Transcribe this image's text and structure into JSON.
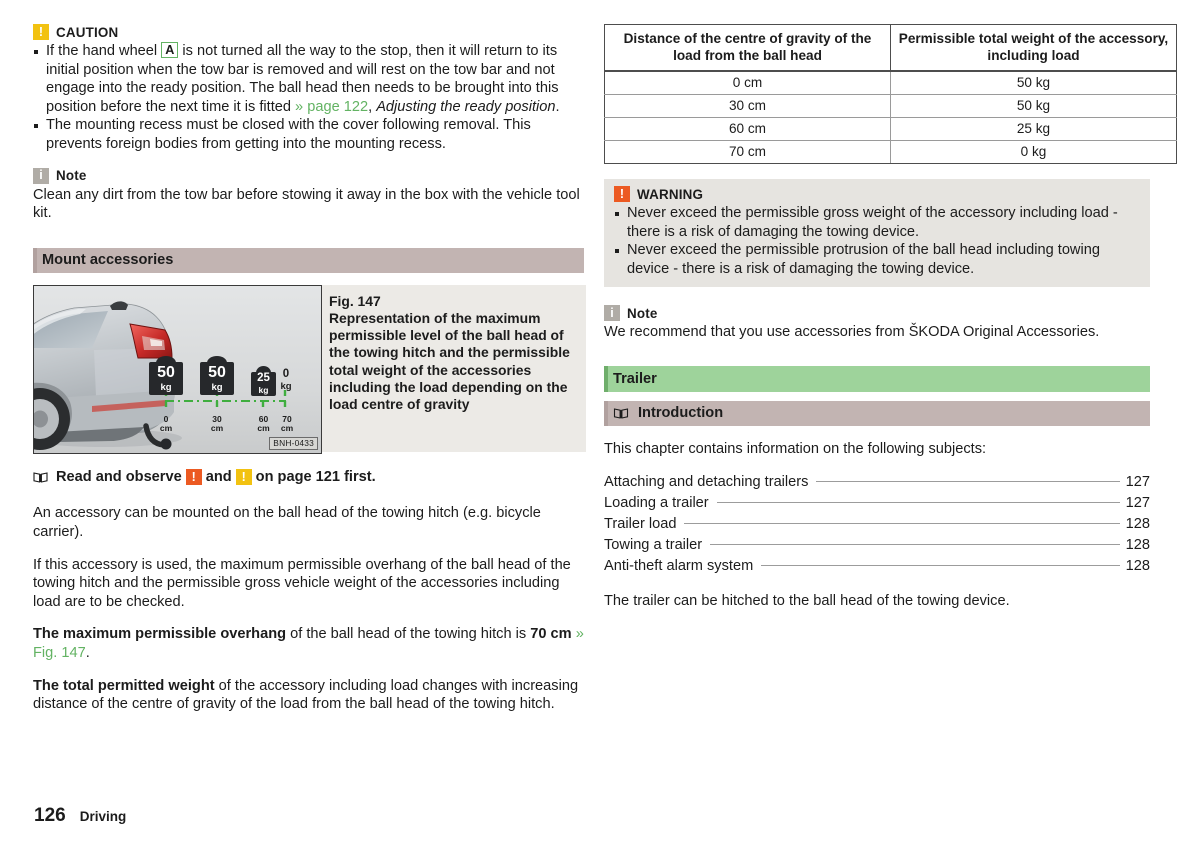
{
  "document": {
    "footer": {
      "page_number": "126",
      "chapter": "Driving"
    }
  },
  "left_column": {
    "caution": {
      "icon": "caution-icon",
      "title": "CAUTION",
      "bullets": [
        {
          "pre": "If the hand wheel ",
          "key": "A",
          "mid": " is not turned all the way to the stop, then it will return to its initial position when the tow bar is removed and will rest on the tow bar and not engage into the ready position. The ball head then needs to be brought into this position before the next time it is fitted ",
          "link": "» page 122",
          "post": ", ",
          "italic": "Adjusting the ready position",
          "end": "."
        },
        {
          "text": "The mounting recess must be closed with the cover following removal. This prevents foreign bodies from getting into the mounting recess."
        }
      ]
    },
    "note": {
      "icon": "note-icon",
      "title": "Note",
      "text": "Clean any dirt from the tow bar before stowing it away in the box with the vehicle tool kit."
    },
    "section_heading": "Mount accessories",
    "figure": {
      "number": "Fig. 147",
      "caption": "Representation of the maximum permissible level of the ball head of the towing hitch and the permissible total weight of the accessories including the load depending on the load centre of gravity",
      "image_id": "BNH-0433",
      "markers": [
        {
          "weight": "50",
          "unit": "kg",
          "distance": "0",
          "distance_unit": "cm"
        },
        {
          "weight": "50",
          "unit": "kg",
          "distance": "30",
          "distance_unit": "cm"
        },
        {
          "weight": "25",
          "unit": "kg",
          "distance": "60",
          "distance_unit": "cm"
        },
        {
          "weight": "0",
          "unit": "kg",
          "distance": "70",
          "distance_unit": "cm"
        }
      ]
    },
    "read_observe": {
      "icon": "book-icon",
      "pre": "Read and observe ",
      "mid": " and ",
      "post": " on page 121 first."
    },
    "paragraphs": [
      {
        "text": "An accessory can be mounted on the ball head of the towing hitch (e.g. bicycle carrier)."
      },
      {
        "text": "If this accessory is used, the maximum permissible overhang of the ball head of the towing hitch and the permissible gross vehicle weight of the accessories including load are to be checked."
      }
    ],
    "overhang_para": {
      "bold": "The maximum permissible overhang",
      "mid": " of the ball head of the towing hitch is ",
      "bold2": "70 cm",
      "link": " » Fig. 147",
      "end": "."
    },
    "weight_para": {
      "bold": "The total permitted weight",
      "rest": " of the accessory including load changes with increasing distance of the centre of gravity of the load from the ball head of the towing hitch."
    }
  },
  "right_column": {
    "table": {
      "headers": [
        "Distance of the centre of gravity of the load from the ball head",
        "Permissible total weight of the accessory, including load"
      ],
      "rows": [
        [
          "0 cm",
          "50 kg"
        ],
        [
          "30 cm",
          "50 kg"
        ],
        [
          "60 cm",
          "25 kg"
        ],
        [
          "70 cm",
          "0 kg"
        ]
      ]
    },
    "warning": {
      "icon": "warning-icon",
      "title": "WARNING",
      "bullets": [
        "Never exceed the permissible gross weight of the accessory including load - there is a risk of damaging the towing device.",
        "Never exceed the permissible protrusion of the ball head including towing device - there is a risk of damaging the towing device."
      ]
    },
    "note": {
      "icon": "note-icon",
      "title": "Note",
      "text": "We recommend that you use accessories from ŠKODA Original Accessories."
    },
    "chapter_heading": "Trailer",
    "subsection_heading": "Introduction",
    "intro_text": "This chapter contains information on the following subjects:",
    "toc": [
      {
        "label": "Attaching and detaching trailers",
        "page": "127"
      },
      {
        "label": "Loading a trailer",
        "page": "127"
      },
      {
        "label": "Trailer load",
        "page": "128"
      },
      {
        "label": "Towing a trailer",
        "page": "128"
      },
      {
        "label": "Anti-theft alarm system",
        "page": "128"
      }
    ],
    "closing_text": "The trailer can be hitched to the ball head of the towing device."
  },
  "colors": {
    "link_green": "#63b363",
    "caution_yellow": "#f2c211",
    "warning_orange": "#ec5a22",
    "note_grey": "#b0aca6",
    "section_taupe": "#c2b4b2",
    "chapter_green": "#9ed39b",
    "admon_bg": "#e6e4e0"
  }
}
